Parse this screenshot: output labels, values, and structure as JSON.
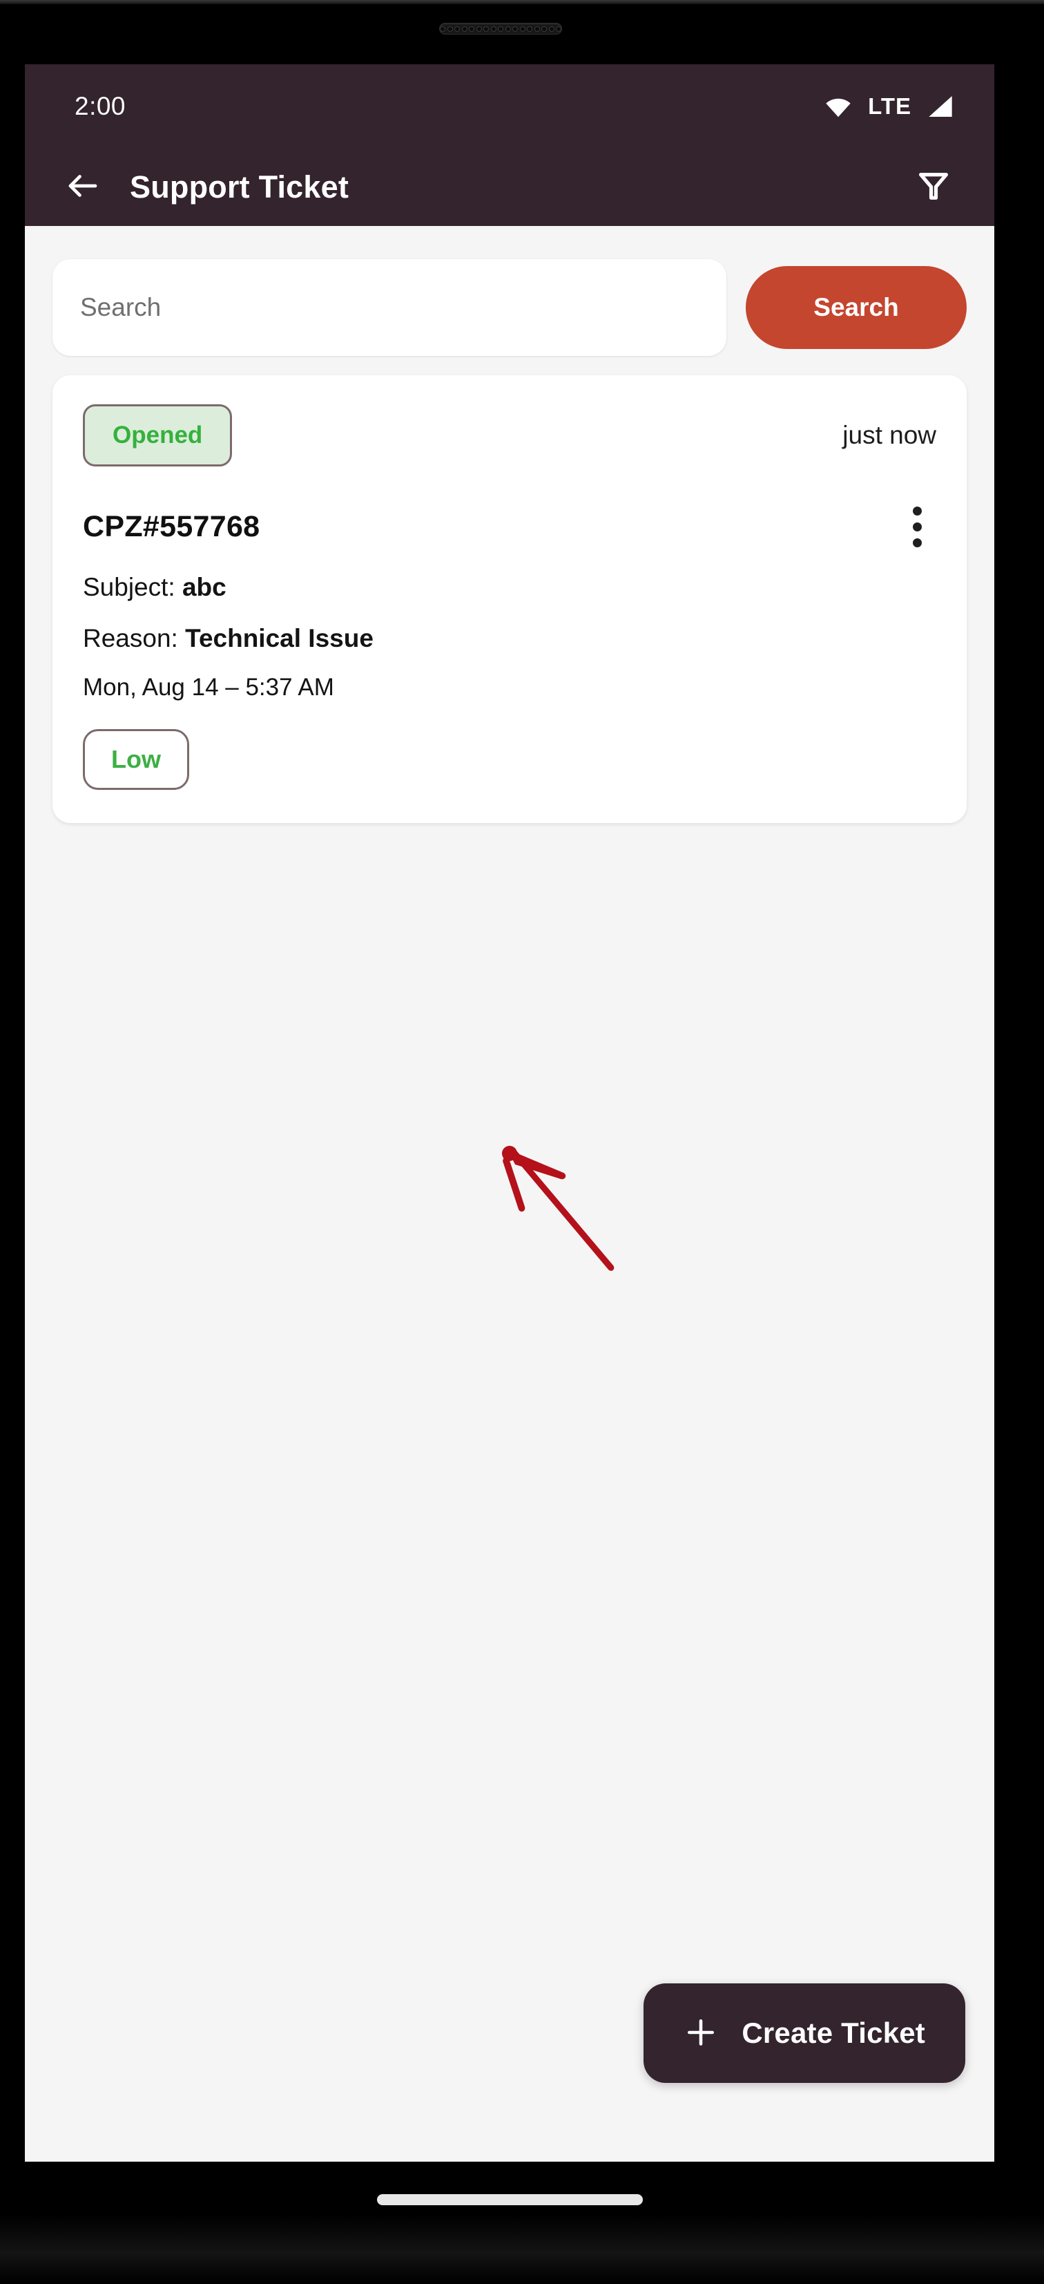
{
  "status_bar": {
    "clock": "2:00",
    "wifi_icon": "wifi-icon",
    "network_label": "LTE",
    "signal_icon": "signal-bars-icon"
  },
  "app_bar": {
    "back_icon": "arrow-left-icon",
    "title": "Support Ticket",
    "filter_icon": "filter-funnel-icon"
  },
  "search": {
    "placeholder": "Search",
    "value": "",
    "button_label": "Search",
    "button_color": "#c4462f"
  },
  "tickets": [
    {
      "status": "Opened",
      "status_color": "#35b13c",
      "status_bg": "#dceddc",
      "time_ago": "just now",
      "id": "CPZ#557768",
      "overflow_icon": "more-vertical-icon",
      "subject_label": "Subject: ",
      "subject_value": "abc",
      "reason_label": "Reason: ",
      "reason_value": "Technical Issue",
      "date": "Mon, Aug 14 – 5:37 AM",
      "priority": "Low",
      "priority_color": "#3cb043"
    }
  ],
  "fab": {
    "plus_icon": "plus-icon",
    "label": "Create Ticket",
    "color": "#33242e"
  },
  "annotation": {
    "arrow_icon": "red-arrow-icon",
    "color": "#b4111a"
  },
  "system": {
    "gesture_pill": "home-gesture-pill",
    "earpiece": "earpiece-speaker"
  },
  "theme": {
    "header_bg": "#33242e",
    "app_bg": "#f5f5f5",
    "card_bg": "#ffffff",
    "badge_border": "#7d6a6a"
  }
}
